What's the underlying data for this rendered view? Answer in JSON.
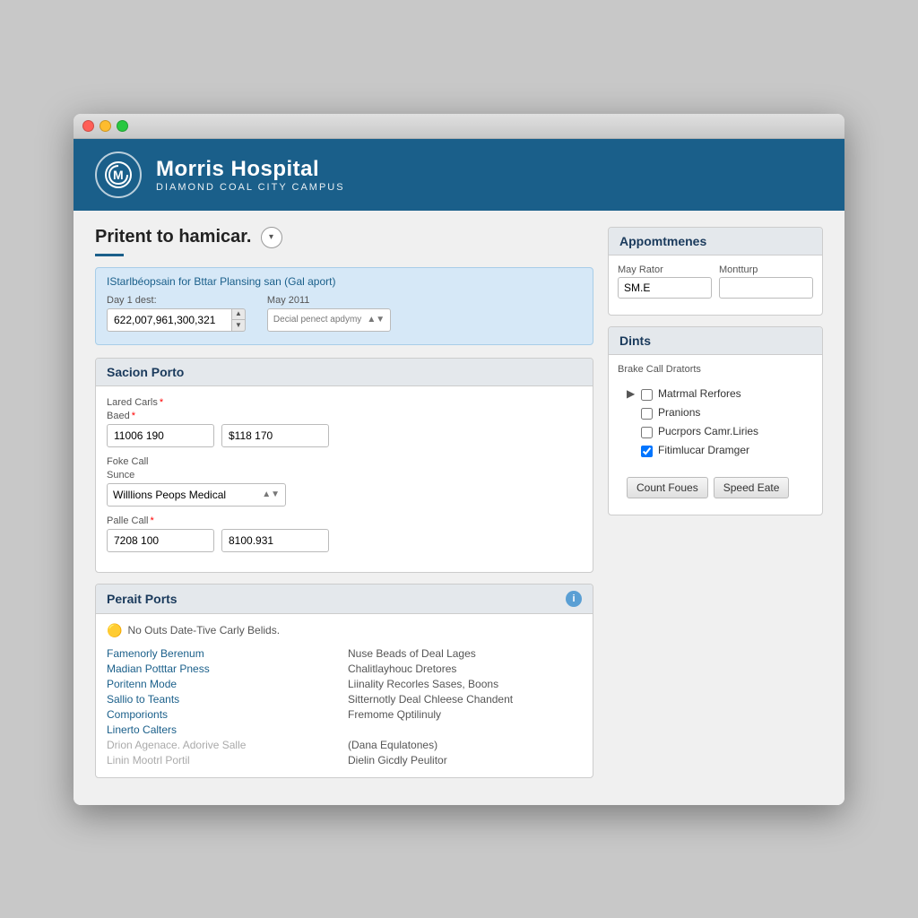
{
  "window": {
    "title": "Morris Hospital"
  },
  "header": {
    "logo_letter": "M",
    "hospital_name": "Morris Hospital",
    "hospital_sub": "Diamond Coal City Campus"
  },
  "page": {
    "title": "Pritent to hamicar.",
    "underline": true
  },
  "info_banner": {
    "text": "IStarlbéopsain for Bttar Plansing san (Gal aport)"
  },
  "top_form": {
    "field1_label": "Day 1 dest:",
    "field1_value": "622,007,961,300,321",
    "field2_label": "May 2011",
    "field2_value": "Decial penect apdymy"
  },
  "sacion_porto": {
    "title": "Sacion Porto",
    "label1": "Lared Carls",
    "label1_required": true,
    "label2": "Baed",
    "label2_required": true,
    "input1_value": "11006 190",
    "input2_value": "$118 170",
    "label3": "Foke Call",
    "label4": "Sunce",
    "select_value": "Willlions Peops Medical",
    "label5": "Palle Call",
    "label5_required": true,
    "input3_value": "7208 100",
    "input4_value": "8100.931"
  },
  "perait_ports": {
    "title": "Perait Ports",
    "warning": "No Outs Date-Tive Carly Belids.",
    "links": [
      {
        "label": "Famenorly Berenum",
        "desc": "Nuse Beads of Deal Lages"
      },
      {
        "label": "Madian Potttar Pness",
        "desc": "Chalitlayhouc Dretores"
      },
      {
        "label": "Poritenn Mode",
        "desc": "Liinality Recorles Sases, Boons"
      },
      {
        "label": "Sallio to Teants",
        "desc": "Sitternotly Deal Chleese Chandent"
      },
      {
        "label": "Comporionts",
        "desc": "Fremome Qptilinuly"
      },
      {
        "label": "Linerto Calters",
        "desc": ""
      },
      {
        "label": "Drion Agenace. Adorive Salle",
        "desc": "(Dana Equlatones)",
        "disabled": true
      },
      {
        "label": "Linin Mootrl Portil",
        "desc": "Dielin Gicdly Peulitor",
        "disabled": true
      }
    ]
  },
  "appointments": {
    "title": "Appomtmenes",
    "label1": "May Rator",
    "label2": "Montturp",
    "input1_value": "SM.E",
    "input2_value": ""
  },
  "dints": {
    "title": "Dints",
    "sublabel": "Brake Call Dratorts",
    "checkboxes": [
      {
        "label": "Matrmal Rerfores",
        "checked": false,
        "has_triangle": true
      },
      {
        "label": "Pranions",
        "checked": false
      },
      {
        "label": "Pucrpors Camr.Liries",
        "checked": false
      },
      {
        "label": "Fitimlucar Dramger",
        "checked": true
      }
    ],
    "btn1": "Count Foues",
    "btn2": "Speed Eate"
  }
}
